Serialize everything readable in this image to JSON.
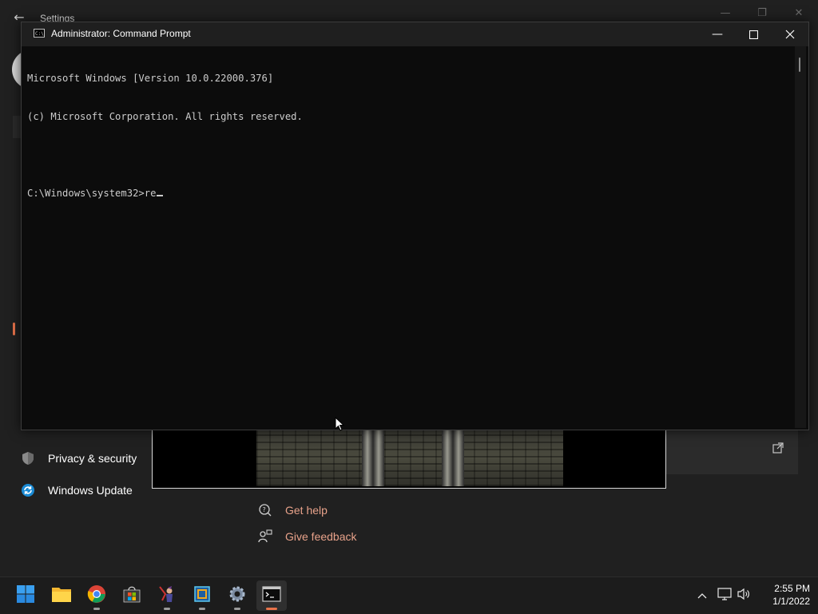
{
  "settings": {
    "title": "Settings",
    "nav": [
      {
        "label": "Privacy & security",
        "icon": "shield-icon"
      },
      {
        "label": "Windows Update",
        "icon": "refresh-icon"
      }
    ],
    "help": [
      {
        "label": "Get help",
        "icon": "help-icon"
      },
      {
        "label": "Give feedback",
        "icon": "feedback-icon"
      }
    ]
  },
  "cmd": {
    "title": "Administrator: Command Prompt",
    "lines": [
      "Microsoft Windows [Version 10.0.22000.376]",
      "(c) Microsoft Corporation. All rights reserved.",
      "",
      "C:\\Windows\\system32>re"
    ]
  },
  "taskbar": {
    "apps": [
      "start-icon",
      "file-explorer-icon",
      "chrome-icon",
      "microsoft-store-icon",
      "game-icon",
      "virtualbox-icon",
      "settings-gear-icon",
      "terminal-icon"
    ],
    "active_app": "terminal-icon",
    "tray_icons": [
      "chevron-up-icon",
      "network-icon",
      "volume-icon"
    ],
    "time": "2:55 PM",
    "date": "1/1/2022"
  },
  "colors": {
    "accent": "#e8734a",
    "link": "#e8a28a",
    "console_bg": "#0c0c0c",
    "console_text": "#cccccc"
  }
}
